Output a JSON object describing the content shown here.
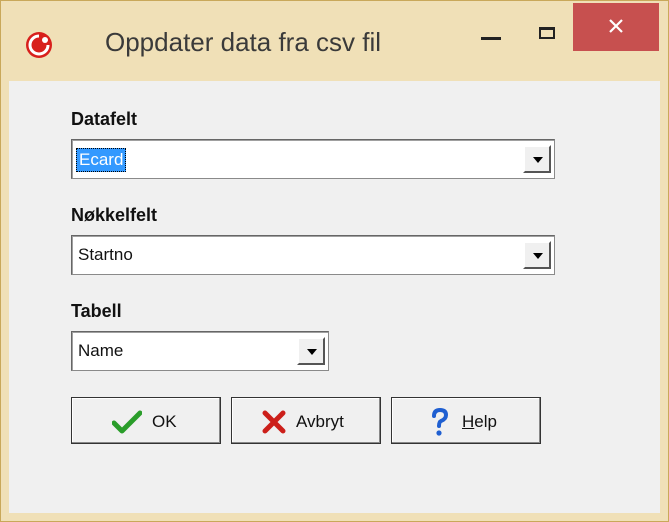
{
  "window": {
    "title": "Oppdater data fra csv fil"
  },
  "fields": {
    "datafelt": {
      "label": "Datafelt",
      "value": "Ecard"
    },
    "nokkelfelt": {
      "label": "Nøkkelfelt",
      "value": "Startno"
    },
    "tabell": {
      "label": "Tabell",
      "value": "Name"
    }
  },
  "buttons": {
    "ok": {
      "label": "OK",
      "icon": "checkmark-icon",
      "color": "#2a9d2a"
    },
    "cancel": {
      "label": "Avbryt",
      "icon": "x-icon",
      "color": "#cc1f1a"
    },
    "help": {
      "label_hotkey": "H",
      "label_rest": "elp",
      "icon": "question-icon",
      "color": "#1f5fd1"
    }
  }
}
